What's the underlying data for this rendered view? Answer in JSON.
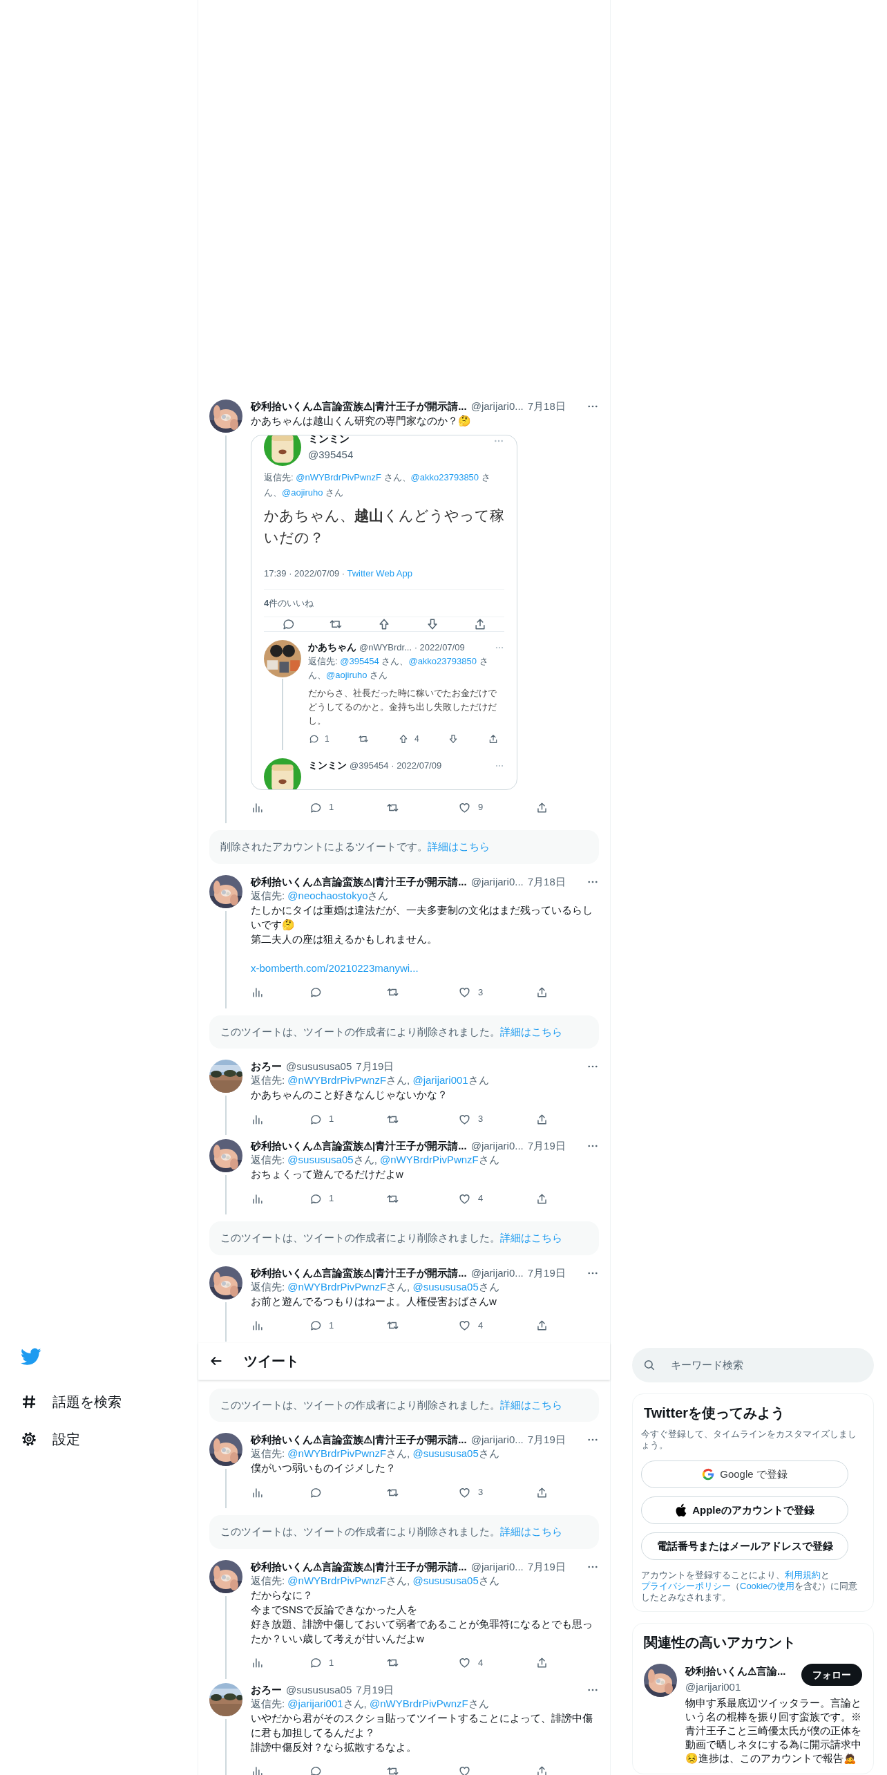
{
  "nav": {
    "items": [
      {
        "kind": "logo"
      },
      {
        "kind": "explore",
        "label": "話題を検索"
      },
      {
        "kind": "settings",
        "label": "設定"
      }
    ]
  },
  "header": {
    "title": "ツイート"
  },
  "timeline": [
    {
      "kind": "tweet",
      "avatar": {
        "kind": "picture"
      },
      "name": "砂利拾いくん⚠言論蛮族⚠|青汁王子が開示請...",
      "handle": "@jarijari0...",
      "date": "7月18日",
      "text": "かあちゃんは越山くん研究の専門家なのか？🤔",
      "embed": {
        "kind": "screenshot",
        "main": {
          "name": "ミンミン",
          "handle": "@395454",
          "reply_label": "返信先:",
          "mentions": [
            {
              "handle": "@nWYBrdrPivPwnzF",
              "suffix": " さん、"
            },
            {
              "handle": "@akko23793850",
              "suffix": " さん、"
            },
            {
              "handle": "@aojiruho",
              "suffix": " さん"
            }
          ],
          "text": "かあちゃん、**越山**くんどうやって稼いだの？",
          "meta": "17:39 · 2022/07/09 · ",
          "source": "Twitter Web App",
          "likes": "**4**件のいいね"
        },
        "replies": [
          {
            "name": "かあちゃん",
            "handle_date": "@nWYBrdr... · 2022/07/09",
            "reply_label": "返信先:",
            "mentions": [
              {
                "handle": "@395454",
                "suffix": " さん、"
              },
              {
                "handle": "@akko23793850",
                "suffix": " さん、"
              },
              {
                "handle": "@aojiruho",
                "suffix": " さん"
              }
            ],
            "text": "だからさ、社長だった時に稼いでたお金だけでどうしてるのかと。金持ち出し失敗しただけだし。",
            "reply_count": "1",
            "up_count": "4"
          },
          {
            "name": "ミンミン",
            "handle_date": "@395454 · 2022/07/09"
          }
        ]
      },
      "reply_count": "1",
      "like_count": "9"
    },
    {
      "kind": "notice",
      "text": "削除されたアカウントによるツイートです。",
      "link": "詳細はこちら"
    },
    {
      "kind": "tweet",
      "avatar": {
        "kind": "picture"
      },
      "name": "砂利拾いくん⚠言論蛮族⚠|青汁王子が開示請...",
      "handle": "@jarijari0...",
      "date": "7月18日",
      "reply_label": "返信先:",
      "mentions": [
        {
          "handle": "@neochaostokyo",
          "suffix": "さん"
        }
      ],
      "text": [
        "たしかにタイは重婚は違法だが、一夫多妻制の文化はまだ残っているらしいです🤔",
        "第二夫人の座は狙えるかもしれません。"
      ],
      "link": "x-bomberth.com/20210223manywi...",
      "like_count": "3"
    },
    {
      "kind": "notice",
      "text": "このツイートは、ツイートの作成者により削除されました。",
      "link": "詳細はこちら"
    },
    {
      "kind": "tweet",
      "avatar": {
        "kind": "picture"
      },
      "name": "おろー",
      "handle": "@susususa05",
      "date": "7月19日",
      "reply_label": "返信先:",
      "mentions": [
        {
          "handle": "@nWYBrdrPivPwnzF",
          "suffix": "さん, "
        },
        {
          "handle": "@jarijari001",
          "suffix": "さん"
        }
      ],
      "text": "かあちゃんのこと好きなんじゃないかな？",
      "reply_count": "1",
      "like_count": "3"
    },
    {
      "kind": "tweet",
      "avatar": {
        "kind": "picture"
      },
      "name": "砂利拾いくん⚠言論蛮族⚠|青汁王子が開示請...",
      "handle": "@jarijari0...",
      "date": "7月19日",
      "reply_label": "返信先:",
      "mentions": [
        {
          "handle": "@susususa05",
          "suffix": "さん, "
        },
        {
          "handle": "@nWYBrdrPivPwnzF",
          "suffix": "さん"
        }
      ],
      "text": "おちょくって遊んでるだけだよw",
      "reply_count": "1",
      "like_count": "4"
    },
    {
      "kind": "notice",
      "text": "このツイートは、ツイートの作成者により削除されました。",
      "link": "詳細はこちら"
    },
    {
      "kind": "tweet",
      "avatar": {
        "kind": "picture"
      },
      "name": "砂利拾いくん⚠言論蛮族⚠|青汁王子が開示請...",
      "handle": "@jarijari0...",
      "date": "7月19日",
      "reply_label": "返信先:",
      "mentions": [
        {
          "handle": "@nWYBrdrPivPwnzF",
          "suffix": "さん, "
        },
        {
          "handle": "@susususa05",
          "suffix": "さん"
        }
      ],
      "text": "お前と遊んでるつもりはねーよ。人権侵害おばさんw",
      "reply_count": "1",
      "like_count": "4"
    },
    {
      "kind": "header"
    },
    {
      "kind": "notice",
      "text": "このツイートは、ツイートの作成者により削除されました。",
      "link": "詳細はこちら"
    },
    {
      "kind": "tweet",
      "avatar": {
        "kind": "picture"
      },
      "name": "砂利拾いくん⚠言論蛮族⚠|青汁王子が開示請...",
      "handle": "@jarijari0...",
      "date": "7月19日",
      "reply_label": "返信先:",
      "mentions": [
        {
          "handle": "@nWYBrdrPivPwnzF",
          "suffix": "さん, "
        },
        {
          "handle": "@susususa05",
          "suffix": "さん"
        }
      ],
      "text": "僕がいつ弱いものイジメした？",
      "like_count": "3"
    },
    {
      "kind": "notice",
      "text": "このツイートは、ツイートの作成者により削除されました。",
      "link": "詳細はこちら"
    },
    {
      "kind": "tweet",
      "avatar": {
        "kind": "picture"
      },
      "name": "砂利拾いくん⚠言論蛮族⚠|青汁王子が開示請...",
      "handle": "@jarijari0...",
      "date": "7月19日",
      "reply_label": "返信先:",
      "mentions": [
        {
          "handle": "@nWYBrdrPivPwnzF",
          "suffix": "さん, "
        },
        {
          "handle": "@susususa05",
          "suffix": "さん"
        }
      ],
      "text": [
        "だからなに？",
        "今までSNSで反論できなかった人を",
        "好き放題、誹謗中傷しておいて弱者であることが免罪符になるとでも思ったか？いい歳して考えが甘いんだよw"
      ],
      "reply_count": "1",
      "like_count": "4"
    },
    {
      "kind": "tweet",
      "avatar": {
        "kind": "picture"
      },
      "name": "おろー",
      "handle": "@susususa05",
      "date": "7月19日",
      "reply_label": "返信先:",
      "mentions": [
        {
          "handle": "@jarijari001",
          "suffix": "さん, "
        },
        {
          "handle": "@nWYBrdrPivPwnzF",
          "suffix": "さん"
        }
      ],
      "text": [
        "いやだから君がそのスクショ貼ってツイートすることによって、誹謗中傷に君も加担してるんだよ？",
        "誹謗中傷反対？なら拡散するなよ。"
      ]
    }
  ],
  "sidebar": {
    "search": {
      "placeholder": "キーワード検索"
    },
    "signup": {
      "title": "Twitterを使ってみよう",
      "subtitle": "今すぐ登録して、タイムラインをカスタマイズしましょう。",
      "buttons": [
        {
          "kind": "google",
          "label": "Google で登録"
        },
        {
          "kind": "apple",
          "label": "Appleのアカウントで登録"
        },
        {
          "kind": "phone",
          "label": "電話番号またはメールアドレスで登録"
        }
      ],
      "legal": [
        {
          "text": "アカウントを登録することにより、",
          "link": false
        },
        {
          "text": "利用規約",
          "link": true
        },
        {
          "text": "と",
          "link": false
        },
        {
          "text": "プライバシーポリシー",
          "link": true
        },
        {
          "text": "（",
          "link": false
        },
        {
          "text": "Cookieの使用",
          "link": true
        },
        {
          "text": "を含む）に同意したとみなされます。",
          "link": false
        }
      ]
    },
    "related": {
      "title": "関連性の高いアカウント",
      "accounts": [
        {
          "name": "砂利拾いくん⚠言論...",
          "handle": "@jarijari001",
          "follow": "フォロー",
          "bio": "物申す系最底辺ツイッタラー。言論という名の棍棒を振り回す蛮族です。※青汁王子こと三崎優太氏が僕の正体を動画で晒しネタにする為に開示請求中😣進捗は、このアカウントで報告🙇"
        }
      ]
    }
  }
}
